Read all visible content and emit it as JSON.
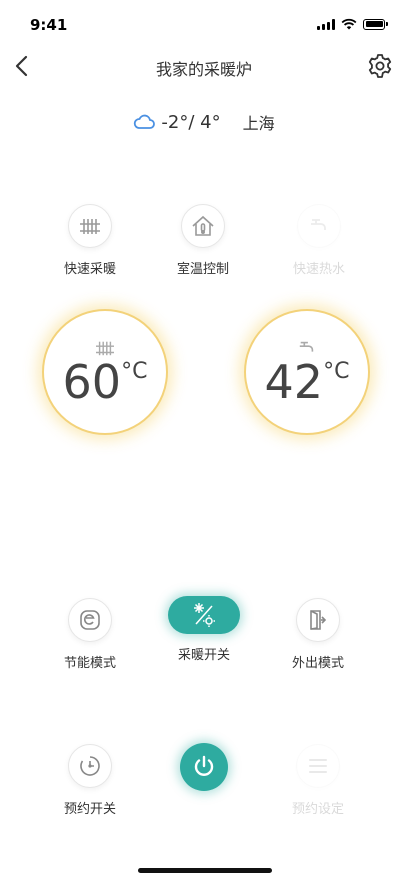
{
  "status": {
    "time": "9:41"
  },
  "header": {
    "title": "我家的采暖炉"
  },
  "weather": {
    "temp": "-2°/ 4°",
    "city": "上海"
  },
  "quick_actions": [
    {
      "label": "快速采暖",
      "icon": "radiator-icon"
    },
    {
      "label": "室温控制",
      "icon": "house-thermometer-icon"
    },
    {
      "label": "快速热水",
      "icon": "faucet-icon"
    }
  ],
  "dials": {
    "heating": {
      "value": "60",
      "unit": "°C",
      "icon": "radiator-icon"
    },
    "water": {
      "value": "42",
      "unit": "°C",
      "icon": "faucet-icon"
    }
  },
  "modes": [
    {
      "label": "节能模式",
      "icon": "eco-icon"
    },
    {
      "label": "采暖开关",
      "icon": "snow-sun-icon"
    },
    {
      "label": "外出模式",
      "icon": "door-icon"
    }
  ],
  "bottom": [
    {
      "label": "预约开关",
      "icon": "timer-icon"
    },
    {
      "label": "",
      "icon": "power-icon"
    },
    {
      "label": "预约设定",
      "icon": "menu-icon"
    }
  ],
  "colors": {
    "accent": "#2eaba0",
    "dial_glow": "#f3d27a",
    "weather_icon": "#4a90e2"
  }
}
